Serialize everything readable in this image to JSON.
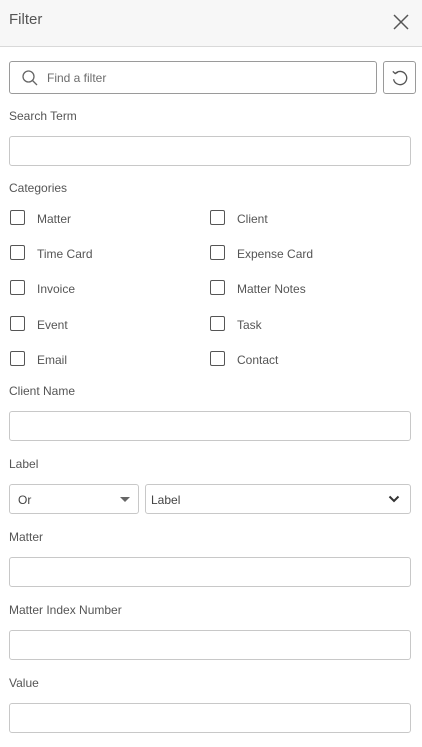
{
  "header": {
    "title": "Filter",
    "close_icon": "close-icon"
  },
  "find": {
    "placeholder": "Find a filter",
    "search_icon": "search-icon",
    "reset_icon": "reset-icon"
  },
  "search_term": {
    "label": "Search Term",
    "value": ""
  },
  "categories": {
    "label": "Categories",
    "items": [
      {
        "label": "Matter",
        "checked": false
      },
      {
        "label": "Client",
        "checked": false
      },
      {
        "label": "Time Card",
        "checked": false
      },
      {
        "label": "Expense Card",
        "checked": false
      },
      {
        "label": "Invoice",
        "checked": false
      },
      {
        "label": "Matter Notes",
        "checked": false
      },
      {
        "label": "Event",
        "checked": false
      },
      {
        "label": "Task",
        "checked": false
      },
      {
        "label": "Email",
        "checked": false
      },
      {
        "label": "Contact",
        "checked": false
      }
    ]
  },
  "client_name": {
    "label": "Client Name",
    "value": ""
  },
  "label_filter": {
    "label": "Label",
    "operator": "Or",
    "select_value": "Label"
  },
  "matter": {
    "label": "Matter",
    "value": ""
  },
  "matter_index_number": {
    "label": "Matter Index Number",
    "value": ""
  },
  "value_field": {
    "label": "Value",
    "value": ""
  }
}
